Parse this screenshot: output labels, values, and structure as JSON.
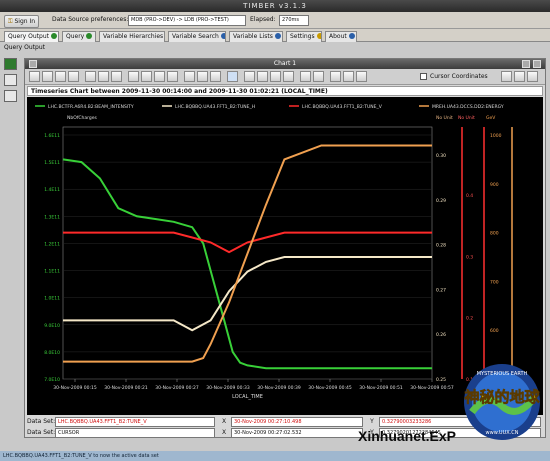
{
  "window": {
    "title": "TIMBER v3.1.3"
  },
  "toolbar": {
    "sign_in": "Sign In",
    "ds_pref_label": "Data Source preferences:",
    "ds_pref_value": "MDB (PRO->DEV) -> LDB (PRO->TEST)",
    "elapsed_label": "Elapsed:",
    "elapsed_value": "270ms"
  },
  "tabs": [
    {
      "label": "Query Output"
    },
    {
      "label": "Query"
    },
    {
      "label": "Variable Hierarchies"
    },
    {
      "label": "Variable Search"
    },
    {
      "label": "Variable Lists"
    },
    {
      "label": "Settings"
    },
    {
      "label": "About"
    }
  ],
  "section_label": "Query Output",
  "chart_window": {
    "title": "Chart 1",
    "cursor_coords_label": "Cursor Coordinates"
  },
  "chart_header": "Timeseries Chart between 2009-11-30 00:14:00 and 2009-11-30 01:02:21 (LOCAL_TIME)",
  "chart_data": {
    "type": "line",
    "title": "Timeseries Chart between 2009-11-30 00:14:00 and 2009-11-30 01:02:21 (LOCAL_TIME)",
    "xlabel": "LOCAL_TIME",
    "left_axis_label": "NbOfCharges",
    "left_ticks": [
      "1.6E11",
      "1.5E11",
      "1.4E11",
      "1.3E11",
      "1.2E11",
      "1.1E11",
      "1.0E11",
      "9.0E10",
      "8.0E10",
      "7.0E10"
    ],
    "right_axis_labels": [
      "No Unit",
      "No Unit",
      "GeV"
    ],
    "right1_ticks": [
      "0.30",
      "0.29",
      "0.28",
      "0.27",
      "0.26",
      "0.25"
    ],
    "right2_ticks": [
      "0.4",
      "0.3",
      "0.2",
      "0.1"
    ],
    "right3_ticks": [
      "1000",
      "900",
      "800",
      "700",
      "600",
      "500"
    ],
    "x_ticks": [
      "30-Nov-2009 00:15",
      "30-Nov-2009 00:21",
      "30-Nov-2009 00:27",
      "30-Nov-2009 00:33",
      "30-Nov-2009 00:39",
      "30-Nov-2009 00:45",
      "30-Nov-2009 00:51",
      "30-Nov-2009 00:57"
    ],
    "series": [
      {
        "name": "LHC.BCTFR.A6R4.B2:BEAM_INTENSITY",
        "color": "#38d038",
        "x": [
          0,
          0.05,
          0.1,
          0.15,
          0.2,
          0.25,
          0.3,
          0.35,
          0.38,
          0.4,
          0.42,
          0.44,
          0.46,
          0.48,
          0.5,
          0.55,
          0.6,
          0.7,
          0.8,
          0.9,
          1.0
        ],
        "y": [
          151000000000.0,
          150000000000.0,
          144000000000.0,
          133000000000.0,
          130000000000.0,
          129000000000.0,
          128000000000.0,
          126000000000.0,
          120000000000.0,
          110000000000.0,
          100000000000.0,
          90000000000.0,
          80000000000.0,
          76000000000.0,
          75000000000.0,
          74000000000.0,
          74000000000.0,
          74000000000.0,
          74000000000.0,
          74000000000.0,
          74000000000.0
        ]
      },
      {
        "name": "LHC.BQBBQ.UA43.FFT1_B2:TUNE_H",
        "color": "#f5e8c8",
        "x": [
          0,
          0.1,
          0.2,
          0.3,
          0.35,
          0.4,
          0.45,
          0.5,
          0.55,
          0.6,
          0.7,
          0.8,
          0.9,
          1.0
        ],
        "y": [
          0.262,
          0.262,
          0.262,
          0.262,
          0.26,
          0.262,
          0.268,
          0.272,
          0.274,
          0.275,
          0.275,
          0.275,
          0.275,
          0.275
        ]
      },
      {
        "name": "LHC.BQBBQ.UA43.FFT1_B2:TUNE_V",
        "color": "#ff2a2a",
        "x": [
          0,
          0.1,
          0.2,
          0.3,
          0.35,
          0.4,
          0.45,
          0.5,
          0.55,
          0.6,
          0.7,
          0.8,
          0.9,
          1.0
        ],
        "y": [
          0.28,
          0.28,
          0.28,
          0.28,
          0.279,
          0.278,
          0.276,
          0.278,
          0.279,
          0.28,
          0.28,
          0.28,
          0.28,
          0.28
        ]
      },
      {
        "name": "MREH.UA43.DCCS.DD2:ENERGY",
        "color": "#f0a050",
        "x": [
          0,
          0.3,
          0.35,
          0.38,
          0.4,
          0.45,
          0.5,
          0.55,
          0.6,
          0.7,
          0.8,
          0.9,
          1.0
        ],
        "y": [
          450,
          450,
          450,
          460,
          500,
          620,
          760,
          900,
          1030,
          1070,
          1070,
          1070,
          1070
        ]
      }
    ]
  },
  "datasets": [
    {
      "label": "Data Set:",
      "name": "LHC.BQBBQ.UA43.FFT1_B2:TUNE_V",
      "time": "30-Nov-2009 00:27:10.498",
      "value": "0.32790003233286"
    },
    {
      "label": "Data Set:",
      "name": "CURSOR",
      "time": "30-Nov-2009 00:27:02.532",
      "value": "0.32790201272284645"
    }
  ],
  "status": "LHC.BQBBQ.UA43.FFT1_B2:TUNE_V to now the active data set",
  "watermark": {
    "text": "Xinhuanet.ExP",
    "cn": "神秘的地球",
    "small": "MYSTERIOUS EARTH",
    "url": "www.UUX.CN"
  }
}
